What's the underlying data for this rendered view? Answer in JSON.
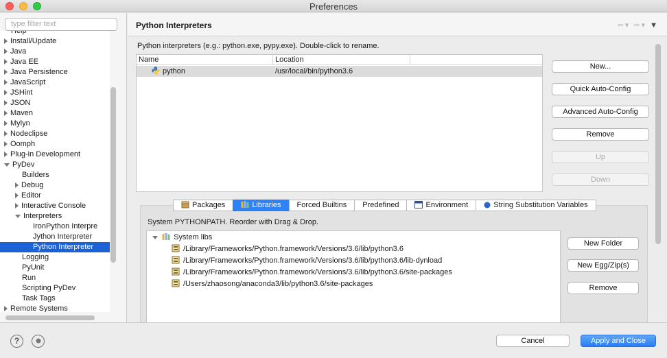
{
  "window": {
    "title": "Preferences"
  },
  "filter": {
    "placeholder": "type filter text"
  },
  "tree": [
    {
      "label": "Help",
      "arrow": "",
      "indent": 0
    },
    {
      "label": "Install/Update",
      "arrow": "closed",
      "indent": 0
    },
    {
      "label": "Java",
      "arrow": "closed",
      "indent": 0
    },
    {
      "label": "Java EE",
      "arrow": "closed",
      "indent": 0
    },
    {
      "label": "Java Persistence",
      "arrow": "closed",
      "indent": 0
    },
    {
      "label": "JavaScript",
      "arrow": "closed",
      "indent": 0
    },
    {
      "label": "JSHint",
      "arrow": "closed",
      "indent": 0
    },
    {
      "label": "JSON",
      "arrow": "closed",
      "indent": 0
    },
    {
      "label": "Maven",
      "arrow": "closed",
      "indent": 0
    },
    {
      "label": "Mylyn",
      "arrow": "closed",
      "indent": 0
    },
    {
      "label": "Nodeclipse",
      "arrow": "closed",
      "indent": 0
    },
    {
      "label": "Oomph",
      "arrow": "closed",
      "indent": 0
    },
    {
      "label": "Plug-in Development",
      "arrow": "closed",
      "indent": 0
    },
    {
      "label": "PyDev",
      "arrow": "open",
      "indent": 0
    },
    {
      "label": "Builders",
      "arrow": "",
      "indent": 1
    },
    {
      "label": "Debug",
      "arrow": "closed",
      "indent": 1
    },
    {
      "label": "Editor",
      "arrow": "closed",
      "indent": 1
    },
    {
      "label": "Interactive Console",
      "arrow": "closed",
      "indent": 1
    },
    {
      "label": "Interpreters",
      "arrow": "open",
      "indent": 1
    },
    {
      "label": "IronPython Interpre",
      "arrow": "",
      "indent": 2
    },
    {
      "label": "Jython Interpreter",
      "arrow": "",
      "indent": 2
    },
    {
      "label": "Python Interpreter",
      "arrow": "",
      "indent": 2,
      "selected": true
    },
    {
      "label": "Logging",
      "arrow": "",
      "indent": 1
    },
    {
      "label": "PyUnit",
      "arrow": "",
      "indent": 1
    },
    {
      "label": "Run",
      "arrow": "",
      "indent": 1
    },
    {
      "label": "Scripting PyDev",
      "arrow": "",
      "indent": 1
    },
    {
      "label": "Task Tags",
      "arrow": "",
      "indent": 1
    },
    {
      "label": "Remote Systems",
      "arrow": "closed",
      "indent": 0
    }
  ],
  "page": {
    "title": "Python Interpreters",
    "description": "Python interpreters (e.g.: python.exe, pypy.exe).   Double-click to rename."
  },
  "interpreters": {
    "columns": [
      "Name",
      "Location"
    ],
    "rows": [
      {
        "name": "python",
        "location": "/usr/local/bin/python3.6"
      }
    ]
  },
  "buttons": {
    "new": "New...",
    "quick": "Quick Auto-Config",
    "advanced": "Advanced Auto-Config",
    "remove": "Remove",
    "up": "Up",
    "down": "Down"
  },
  "tabs": [
    "Packages",
    "Libraries",
    "Forced Builtins",
    "Predefined",
    "Environment",
    "String Substitution Variables"
  ],
  "active_tab": "Libraries",
  "libraries": {
    "description": "System PYTHONPATH.   Reorder with Drag & Drop.",
    "root": "System libs",
    "paths": [
      "/Library/Frameworks/Python.framework/Versions/3.6/lib/python3.6",
      "/Library/Frameworks/Python.framework/Versions/3.6/lib/python3.6/lib-dynload",
      "/Library/Frameworks/Python.framework/Versions/3.6/lib/python3.6/site-packages",
      "/Users/zhaosong/anaconda3/lib/python3.6/site-packages"
    ],
    "buttons": {
      "new_folder": "New Folder",
      "new_egg": "New Egg/Zip(s)",
      "remove": "Remove"
    }
  },
  "footer": {
    "cancel": "Cancel",
    "apply": "Apply and Close",
    "help": "?"
  },
  "colors": {
    "selection": "#1a62d5",
    "primary": "#2a7df5",
    "active_tab": "#2f83f6"
  }
}
